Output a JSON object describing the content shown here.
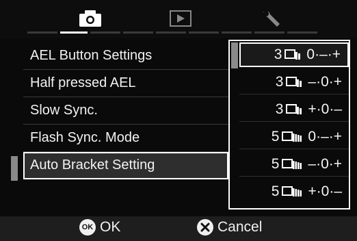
{
  "tabs": [
    {
      "name": "camera-icon"
    },
    {
      "name": "play-icon"
    },
    {
      "name": "wrench-icon"
    }
  ],
  "menu": {
    "items": [
      {
        "label": "AEL Button Settings"
      },
      {
        "label": "Half pressed AEL"
      },
      {
        "label": "Slow Sync."
      },
      {
        "label": "Flash Sync. Mode"
      },
      {
        "label": "Auto Bracket Setting"
      }
    ],
    "selected_index": 4
  },
  "popup": {
    "options": [
      {
        "count": "3",
        "sequence": "0·–·+"
      },
      {
        "count": "3",
        "sequence": "–·0·+"
      },
      {
        "count": "3",
        "sequence": "+·0·–"
      },
      {
        "count": "5",
        "sequence": "0·–·+"
      },
      {
        "count": "5",
        "sequence": "–·0·+"
      },
      {
        "count": "5",
        "sequence": "+·0·–"
      }
    ],
    "selected_index": 0
  },
  "bottom": {
    "ok_badge": "OK",
    "ok_label": "OK",
    "cancel_label": "Cancel"
  },
  "colors": {
    "background": "#0a0a0a",
    "selection": "#2e2e2e",
    "text": "#f2f2f2",
    "accent_gray": "#8a8a8a"
  }
}
